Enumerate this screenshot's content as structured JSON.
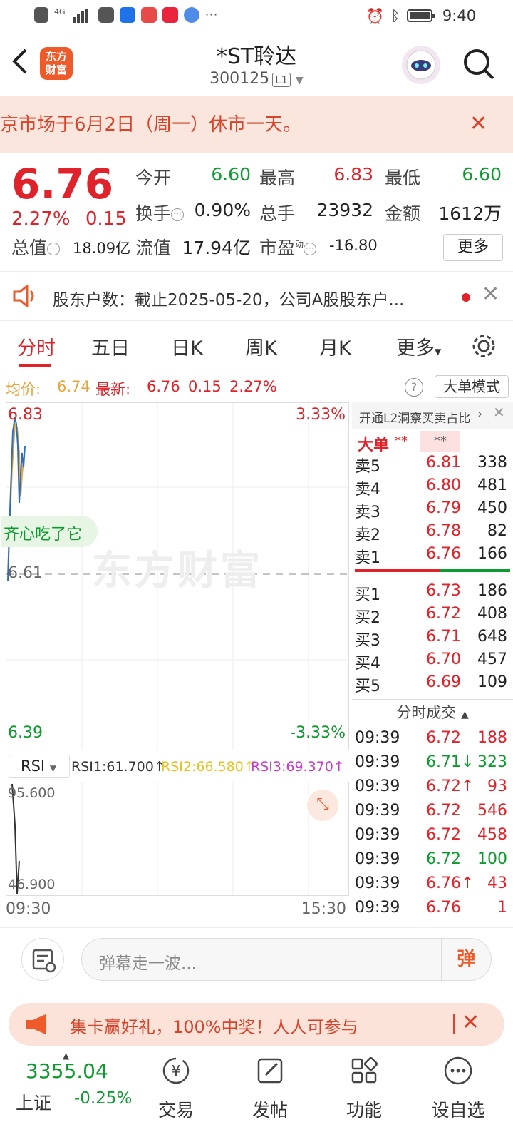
{
  "status_bar": {
    "time": "9:40",
    "network": "4G"
  },
  "header": {
    "title": "*ST聆达",
    "code": "300125",
    "level_badge": "L1",
    "logo_line1": "东方",
    "logo_line2": "财富"
  },
  "notice": {
    "text": "京市场于6月2日（周一）休市一天。"
  },
  "quote": {
    "price": "6.76",
    "change_pct": "2.27%",
    "change_abs": "0.15",
    "open_label": "今开",
    "open": "6.60",
    "high_label": "最高",
    "high": "6.83",
    "low_label": "最低",
    "low": "6.60",
    "turnover_label": "换手",
    "turnover": "0.90%",
    "volume_label": "总手",
    "volume": "23932",
    "amount_label": "金额",
    "amount": "1612万",
    "mktcap_label": "总值",
    "mktcap": "18.09亿",
    "float_label": "流值",
    "float_cap": "17.94亿",
    "pe_label": "市盈",
    "pe_sup": "动",
    "pe": "-16.80",
    "more_label": "更多"
  },
  "shareholder": {
    "text": "股东户数：截止2025-05-20，公司A股股东户..."
  },
  "tabs": [
    "分时",
    "五日",
    "日K",
    "周K",
    "月K",
    "更多"
  ],
  "avgline": {
    "avg_label": "均价:",
    "avg_value": "6.74",
    "latest_label": "最新:",
    "latest": "6.76",
    "chg": "0.15",
    "pct": "2.27%",
    "mode_button": "大单模式"
  },
  "chart": {
    "top_price": "6.83",
    "top_pct": "3.33%",
    "bottom_price": "6.39",
    "bottom_pct": "-3.33%",
    "mid_price": "6.61",
    "watermark": "东方财富",
    "bubble_text": "齐心吃了它"
  },
  "rsi": {
    "selector": "RSI",
    "rsi1": "RSI1:61.700↑",
    "rsi2": "RSI2:66.580↑",
    "rsi3": "RSI3:69.370↑",
    "top": "95.600",
    "bottom": "46.900"
  },
  "time_axis": {
    "start": "09:30",
    "end": "15:30"
  },
  "orderbook": {
    "l2_link": "开通L2洞察买卖占比",
    "big_order_label": "大单",
    "big_order_v1": "**",
    "big_order_v2": "**",
    "sells": [
      {
        "label": "卖5",
        "price": "6.81",
        "vol": "338"
      },
      {
        "label": "卖4",
        "price": "6.80",
        "vol": "481"
      },
      {
        "label": "卖3",
        "price": "6.79",
        "vol": "450"
      },
      {
        "label": "卖2",
        "price": "6.78",
        "vol": "82"
      },
      {
        "label": "卖1",
        "price": "6.76",
        "vol": "166"
      }
    ],
    "buys": [
      {
        "label": "买1",
        "price": "6.73",
        "vol": "186"
      },
      {
        "label": "买2",
        "price": "6.72",
        "vol": "408"
      },
      {
        "label": "买3",
        "price": "6.71",
        "vol": "648"
      },
      {
        "label": "买4",
        "price": "6.70",
        "vol": "457"
      },
      {
        "label": "买5",
        "price": "6.69",
        "vol": "109"
      }
    ],
    "trades_title": "分时成交",
    "trades": [
      {
        "time": "09:39",
        "price": "6.72",
        "vol": "188",
        "color": "#e0232b"
      },
      {
        "time": "09:39",
        "price": "6.71↓",
        "vol": "323",
        "color": "#0d9b2f"
      },
      {
        "time": "09:39",
        "price": "6.72↑",
        "vol": "93",
        "color": "#e0232b"
      },
      {
        "time": "09:39",
        "price": "6.72",
        "vol": "546",
        "color": "#e0232b"
      },
      {
        "time": "09:39",
        "price": "6.72",
        "vol": "458",
        "color": "#e0232b"
      },
      {
        "time": "09:39",
        "price": "6.72",
        "vol": "100",
        "color": "#0d9b2f"
      },
      {
        "time": "09:39",
        "price": "6.76↑",
        "vol": "43",
        "color": "#e0232b"
      },
      {
        "time": "09:39",
        "price": "6.76",
        "vol": "1",
        "color": "#e0232b"
      }
    ]
  },
  "danmu": {
    "placeholder": "弹幕走一波...",
    "send": "弹"
  },
  "promo": {
    "text": "集卡赢好礼，100%中奖！人人可参与"
  },
  "bottom_nav": {
    "index_value": "3355.04",
    "index_name": "上证",
    "index_pct": "-0.25%",
    "items": [
      "交易",
      "发帖",
      "功能",
      "设自选"
    ]
  }
}
